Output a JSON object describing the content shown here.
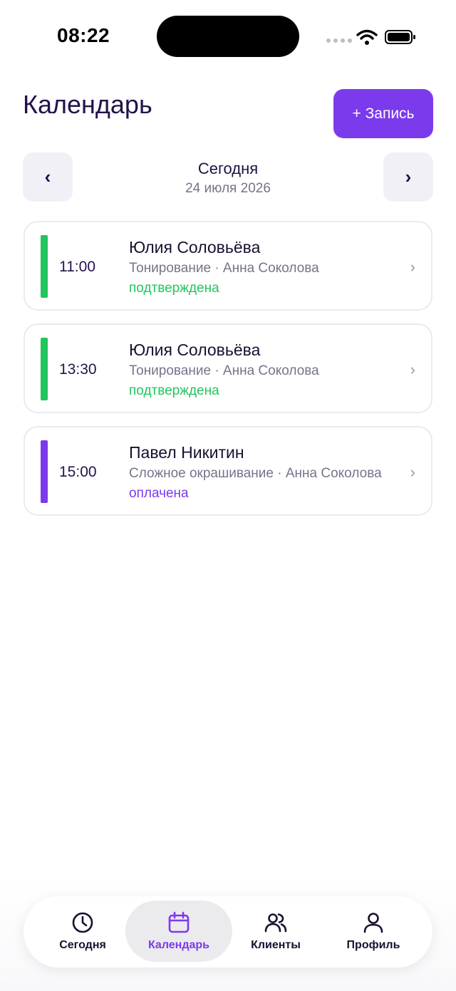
{
  "status_bar": {
    "time": "08:22"
  },
  "header": {
    "title": "Календарь",
    "add_button_label": "+ Запись"
  },
  "date_nav": {
    "prev_label": "‹",
    "next_label": "›",
    "title": "Сегодня",
    "date": "24 июля 2026"
  },
  "appointments": [
    {
      "time": "11:00",
      "client": "Юлия Соловьёва",
      "service": "Тонирование · Анна Соколова",
      "status": "подтверждена",
      "color": "#22c55e"
    },
    {
      "time": "13:30",
      "client": "Юлия Соловьёва",
      "service": "Тонирование · Анна Соколова",
      "status": "подтверждена",
      "color": "#22c55e"
    },
    {
      "time": "15:00",
      "client": "Павел Никитин",
      "service": "Сложное окрашивание · Анна Соколова",
      "status": "оплачена",
      "color": "#7c3aed"
    }
  ],
  "tabbar": {
    "active": "calendar",
    "items": [
      {
        "id": "today",
        "label": "Сегодня",
        "icon": "clock-icon"
      },
      {
        "id": "calendar",
        "label": "Календарь",
        "icon": "calendar-icon"
      },
      {
        "id": "clients",
        "label": "Клиенты",
        "icon": "users-icon"
      },
      {
        "id": "profile",
        "label": "Профиль",
        "icon": "user-icon"
      }
    ]
  },
  "colors": {
    "accent": "#7c3aed",
    "confirmed": "#22c55e"
  }
}
